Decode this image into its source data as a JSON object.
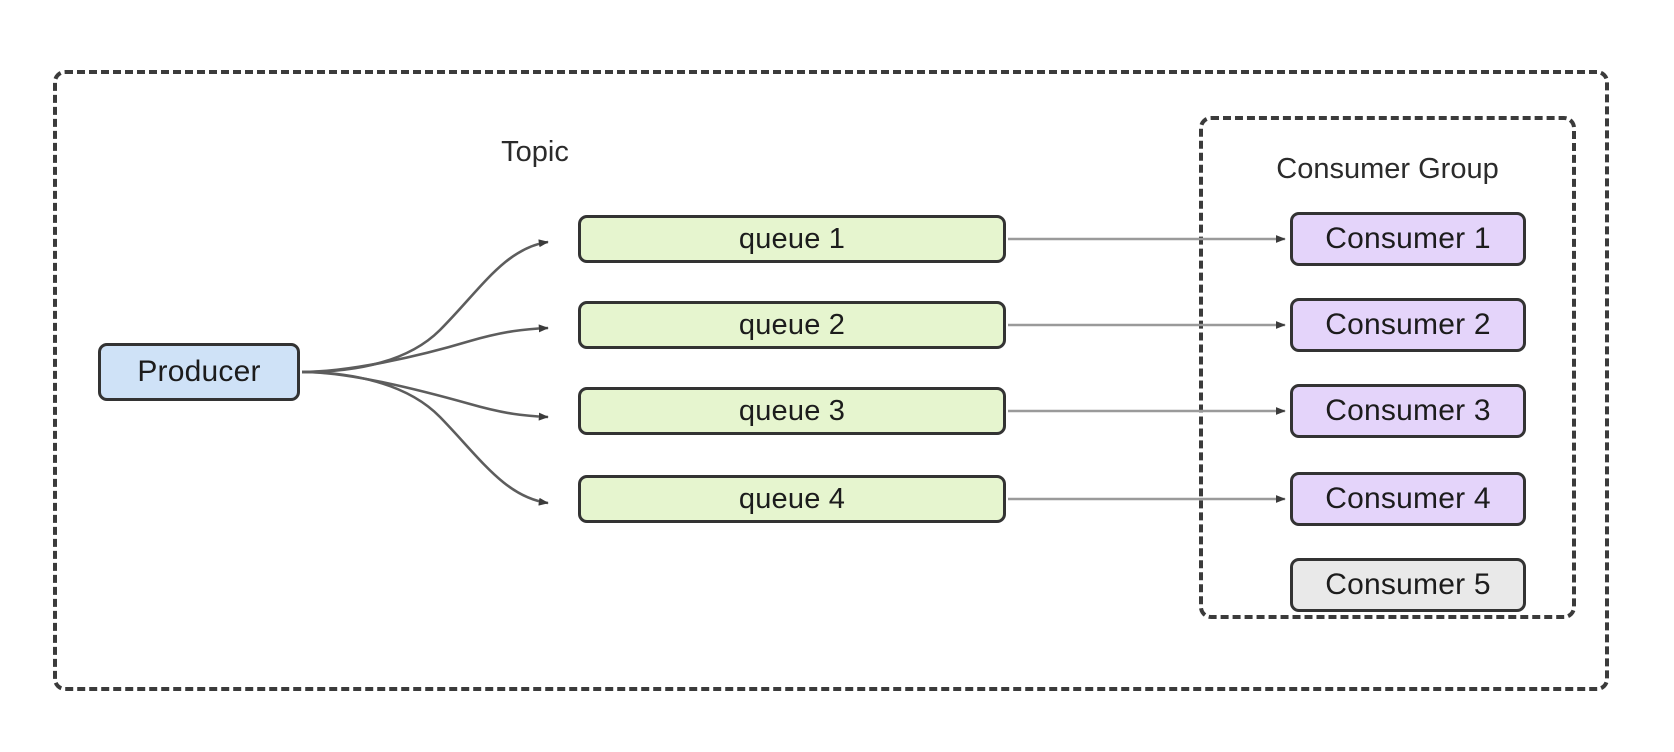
{
  "diagram": {
    "title": "Message queue fan-out with consumer group",
    "background": "#ffffff",
    "outer_group": {
      "name": "message-broker-boundary",
      "style": "dashed"
    }
  },
  "labels": {
    "topic": "Topic",
    "consumer_group": "Consumer Group"
  },
  "producer": {
    "label": "Producer",
    "color": "#cfe2f7",
    "border": "#333333"
  },
  "queues": [
    {
      "label": "queue 1",
      "color": "#e6f5cf"
    },
    {
      "label": "queue 2",
      "color": "#e6f5cf"
    },
    {
      "label": "queue 3",
      "color": "#e6f5cf"
    },
    {
      "label": "queue 4",
      "color": "#e6f5cf"
    }
  ],
  "consumers": [
    {
      "label": "Consumer 1",
      "color": "#e4d4fa",
      "state": "active"
    },
    {
      "label": "Consumer 2",
      "color": "#e4d4fa",
      "state": "active"
    },
    {
      "label": "Consumer 3",
      "color": "#e4d4fa",
      "state": "active"
    },
    {
      "label": "Consumer 4",
      "color": "#e4d4fa",
      "state": "active"
    },
    {
      "label": "Consumer 5",
      "color": "#e9e9e9",
      "state": "idle"
    }
  ],
  "edges": {
    "producer_to_queues": 4,
    "queue_to_consumer": 4,
    "arrow_color": "#6e6e6e",
    "arrowhead_color": "#3b3b3b"
  }
}
